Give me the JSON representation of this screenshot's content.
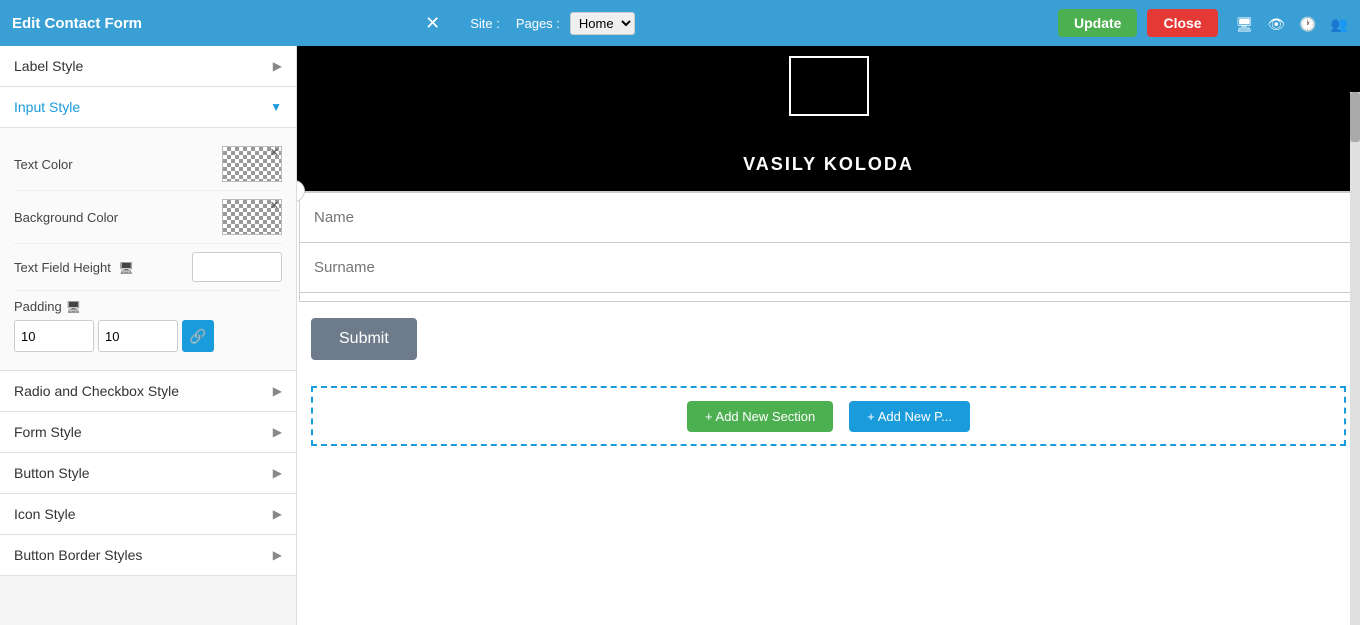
{
  "topbar": {
    "title": "Edit Contact Form",
    "close_x": "✕",
    "site_label": "Site :",
    "pages_label": "Pages :",
    "pages_value": "Home",
    "update_label": "Update",
    "close_label": "Close"
  },
  "left_panel": {
    "label_style": {
      "label": "Label Style",
      "expanded": false
    },
    "input_style": {
      "label": "Input Style",
      "expanded": true,
      "text_color_label": "Text Color",
      "bg_color_label": "Background Color",
      "text_field_height_label": "Text Field Height",
      "padding_label": "Padding",
      "padding_val1": "10",
      "padding_val2": "10"
    },
    "radio_checkbox_style": {
      "label": "Radio and Checkbox Style"
    },
    "form_style": {
      "label": "Form Style"
    },
    "button_style": {
      "label": "Button Style"
    },
    "icon_style": {
      "label": "Icon Style"
    },
    "button_border_styles": {
      "label": "Button Border Styles"
    }
  },
  "canvas": {
    "person_name": "VASILY KOLODA",
    "form_fields": [
      {
        "placeholder": "Name"
      },
      {
        "placeholder": "Surname"
      }
    ],
    "submit_label": "Submit",
    "add_section_label": "+ Add New Section",
    "add_page_label": "+ Add New P..."
  }
}
